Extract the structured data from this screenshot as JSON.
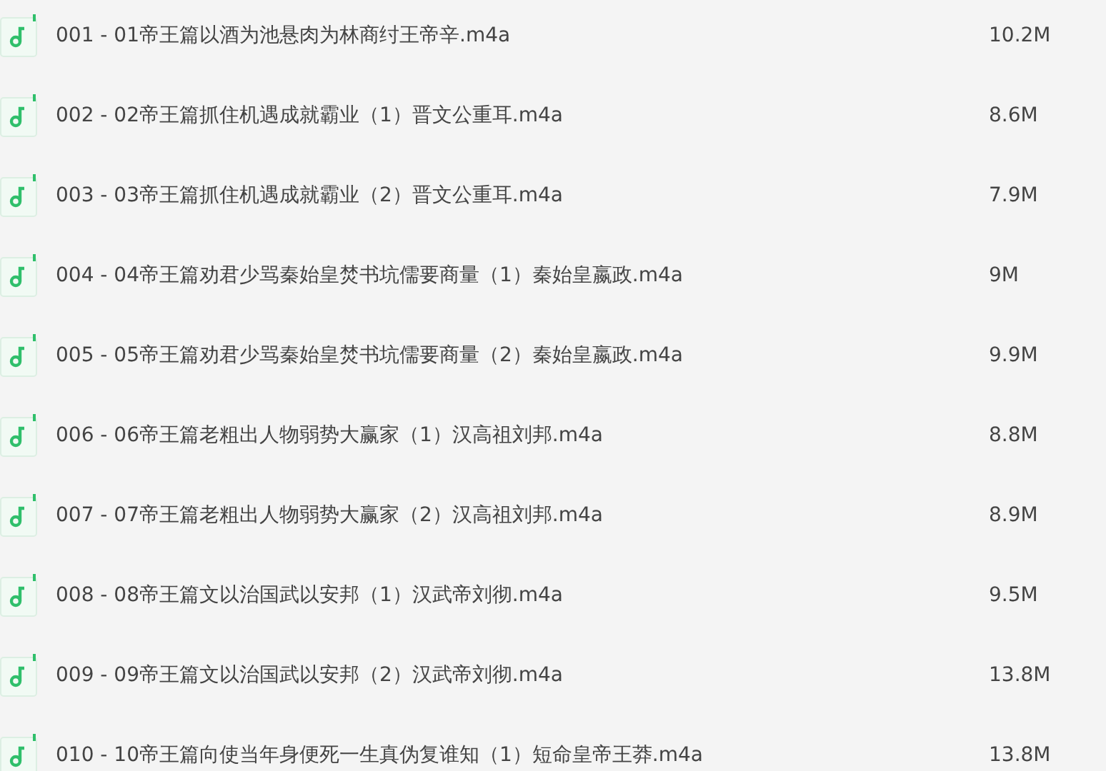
{
  "files": [
    {
      "name": "001 - 01帝王篇以酒为池悬肉为林商纣王帝辛.m4a",
      "size": "10.2M"
    },
    {
      "name": "002 - 02帝王篇抓住机遇成就霸业（1）晋文公重耳.m4a",
      "size": "8.6M"
    },
    {
      "name": "003 - 03帝王篇抓住机遇成就霸业（2）晋文公重耳.m4a",
      "size": "7.9M"
    },
    {
      "name": "004 - 04帝王篇劝君少骂秦始皇焚书坑儒要商量（1）秦始皇嬴政.m4a",
      "size": "9M"
    },
    {
      "name": "005 - 05帝王篇劝君少骂秦始皇焚书坑儒要商量（2）秦始皇嬴政.m4a",
      "size": "9.9M"
    },
    {
      "name": "006 - 06帝王篇老粗出人物弱势大赢家（1）汉高祖刘邦.m4a",
      "size": "8.8M"
    },
    {
      "name": "007 - 07帝王篇老粗出人物弱势大赢家（2）汉高祖刘邦.m4a",
      "size": "8.9M"
    },
    {
      "name": "008 - 08帝王篇文以治国武以安邦（1）汉武帝刘彻.m4a",
      "size": "9.5M"
    },
    {
      "name": "009 - 09帝王篇文以治国武以安邦（2）汉武帝刘彻.m4a",
      "size": "13.8M"
    },
    {
      "name": "010 - 10帝王篇向使当年身便死一生真伪复谁知（1）短命皇帝王莽.m4a",
      "size": "13.8M"
    }
  ]
}
